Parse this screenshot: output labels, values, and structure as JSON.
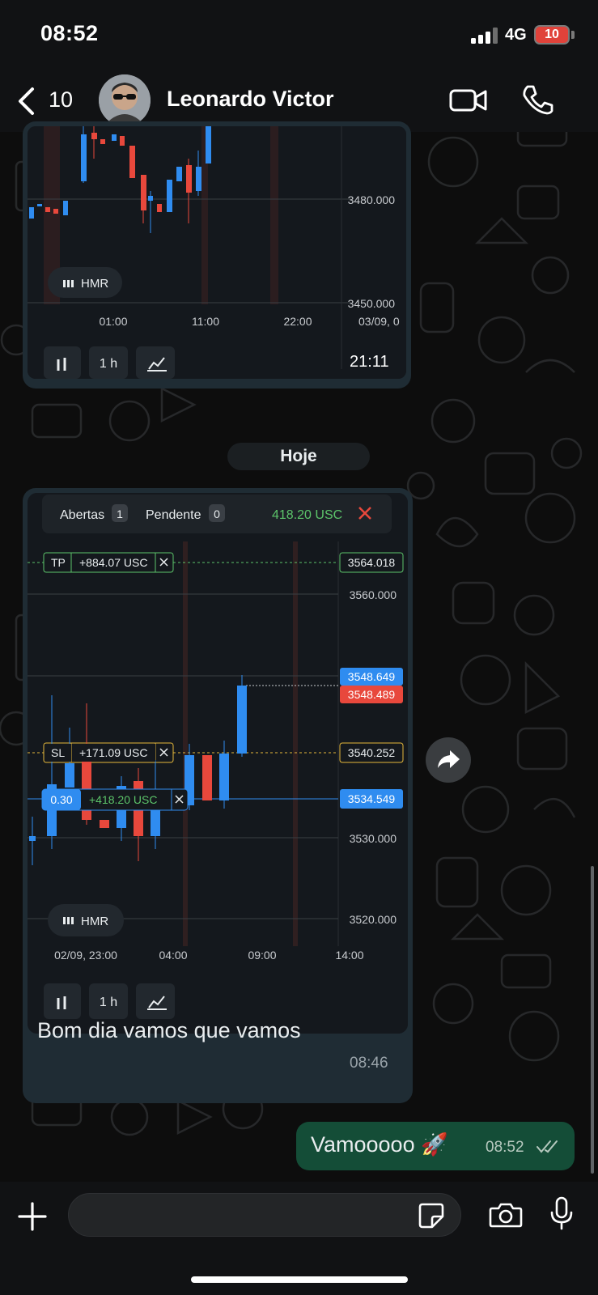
{
  "status": {
    "time": "08:52",
    "network": "4G",
    "battery": "10"
  },
  "header": {
    "back_count": "10",
    "contact_name": "Leonardo Victor"
  },
  "chart1": {
    "price_labels": [
      "3480.000",
      "3450.000"
    ],
    "time_labels": [
      "01:00",
      "11:00",
      "22:00",
      "03/09, 0"
    ],
    "indicator_label": "HMR",
    "interval_label": "1 h",
    "sent_time": "21:11"
  },
  "date_separator": "Hoje",
  "chart2": {
    "tabs": {
      "open_label": "Abertas",
      "open_count": "1",
      "pending_label": "Pendente",
      "pending_count": "0",
      "total": "418.20 USC"
    },
    "tp": {
      "label": "TP",
      "value": "+884.07 USC",
      "price": "3564.018"
    },
    "sl": {
      "label": "SL",
      "value": "+171.09 USC",
      "price": "3540.252"
    },
    "position": {
      "lot": "0.30",
      "value": "+418.20 USC",
      "price": "3534.549"
    },
    "bid": "3548.649",
    "ask": "3548.489",
    "price_labels": [
      "3560.000",
      "3530.000",
      "3520.000"
    ],
    "time_labels": [
      "02/09, 23:00",
      "04:00",
      "09:00",
      "14:00"
    ],
    "indicator_label": "HMR",
    "interval_label": "1 h",
    "colors": {
      "bull": "#2f8cf0",
      "bear": "#e8483c",
      "profit": "#5cc46a"
    }
  },
  "message_in": {
    "text": "Bom dia  vamos que vamos",
    "time": "08:46"
  },
  "message_out": {
    "text": "Vamooooo 🚀",
    "time": "08:52",
    "status_icon": "double-check-icon"
  },
  "composer": {
    "placeholder": ""
  }
}
